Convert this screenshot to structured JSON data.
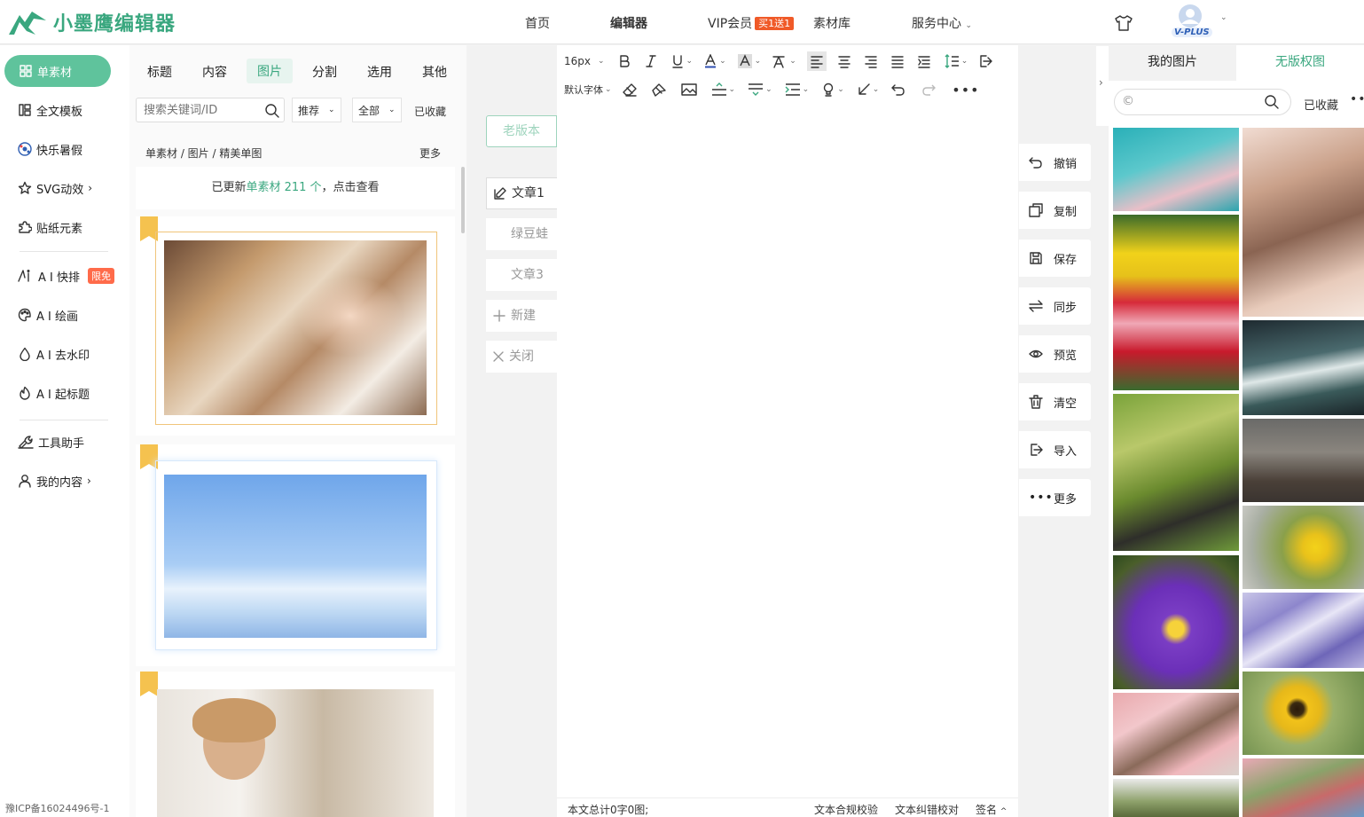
{
  "brand": {
    "name": "小墨鹰编辑器"
  },
  "topnav": {
    "home": "首页",
    "editor": "编辑器",
    "vip": "VIP会员",
    "vip_badge": "买1送1",
    "library": "素材库",
    "service": "服务中心"
  },
  "user": {
    "plus": "V-PLUS"
  },
  "leftnav": {
    "items": [
      {
        "label": "单素材",
        "icon": "grid-icon"
      },
      {
        "label": "全文模板",
        "icon": "template-icon"
      },
      {
        "label": "快乐暑假",
        "icon": "ball-icon"
      },
      {
        "label": "SVG动效",
        "icon": "star-icon"
      },
      {
        "label": "贴纸元素",
        "icon": "puzzle-icon"
      },
      {
        "label": "A I 快排",
        "icon": "ai-icon",
        "badge": "限免"
      },
      {
        "label": "A I 绘画",
        "icon": "palette-icon"
      },
      {
        "label": "A I 去水印",
        "icon": "drop-icon"
      },
      {
        "label": "A I 起标题",
        "icon": "fire-icon"
      },
      {
        "label": "工具助手",
        "icon": "tool-icon"
      },
      {
        "label": "我的内容",
        "icon": "user-icon"
      }
    ]
  },
  "material": {
    "tabs": [
      "标题",
      "内容",
      "图片",
      "分割",
      "选用",
      "其他"
    ],
    "active_tab": "图片",
    "search_placeholder": "搜索关键词/ID",
    "filter1": "推荐",
    "filter2": "全部",
    "favorites": "已收藏",
    "breadcrumb": "单素材 / 图片 / 精美单图",
    "more": "更多",
    "update_prefix": "已更新",
    "update_count": "单素材 211 个",
    "update_suffix": "，点击查看"
  },
  "docs": {
    "old_version": "老版本",
    "items": [
      "文章1",
      "绿豆蛙",
      "文章3"
    ],
    "new": "新建",
    "close": "关闭"
  },
  "toolbar": {
    "font_size": "16px",
    "font_family": "默认字体"
  },
  "footer": {
    "count": "本文总计0字0图;",
    "check1": "文本合规校验",
    "check2": "文本纠错校对",
    "sign": "签名"
  },
  "actions": [
    "撤销",
    "复制",
    "保存",
    "同步",
    "预览",
    "清空",
    "导入",
    "更多"
  ],
  "right": {
    "tab_mine": "我的图片",
    "tab_free": "无版权图",
    "favorites": "已收藏"
  },
  "icp": "豫ICP备16024496号-1",
  "colors": {
    "accent": "#3aa77f",
    "accent_light": "#5fc39c",
    "badge": "#f05a28"
  }
}
